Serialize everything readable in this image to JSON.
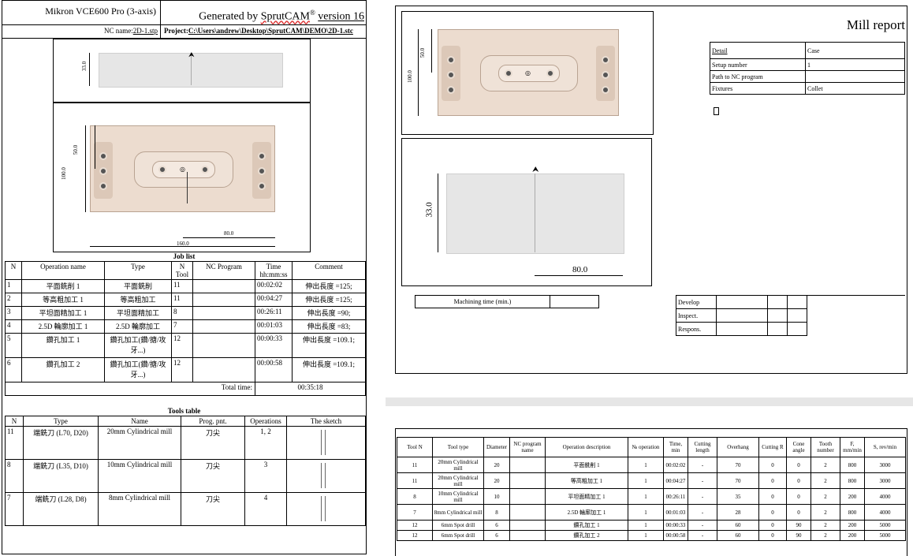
{
  "header": {
    "machine": "Mikron VCE600 Pro (3-axis)",
    "generated_prefix": "Generated by ",
    "product": "SprutCAM",
    "registered": "®",
    "version": "version 16",
    "nc_name_label": "NC name:",
    "nc_name_value": "2D-1.stp",
    "project_label": "Project:",
    "project_path": "C:\\Users\\andrew\\Desktop\\SprutCAM\\DEMO\\2D-1.stc"
  },
  "dims": {
    "top_height": "33.0",
    "inner_height": "50.0",
    "total_height": "100.0",
    "half_width": "80.0",
    "total_width": "160.0"
  },
  "job_list": {
    "title": "Job list",
    "headers": [
      "N",
      "Operation name",
      "Type",
      "N Tool",
      "NC Program",
      "Time hh:mm:ss",
      "Comment"
    ],
    "rows": [
      {
        "n": "1",
        "name": "平面銑削 1",
        "type": "平面銑削",
        "tool": "11",
        "nc": "",
        "time": "00:02:02",
        "comment": "伸出長度 =125;"
      },
      {
        "n": "2",
        "name": "等高粗加工 1",
        "type": "等高粗加工",
        "tool": "11",
        "nc": "",
        "time": "00:04:27",
        "comment": "伸出長度 =125;"
      },
      {
        "n": "3",
        "name": "平坦面精加工 1",
        "type": "平坦面精加工",
        "tool": "8",
        "nc": "",
        "time": "00:26:11",
        "comment": "伸出長度 =90;"
      },
      {
        "n": "4",
        "name": "2.5D 輪廓加工 1",
        "type": "2.5D 輪廓加工",
        "tool": "7",
        "nc": "",
        "time": "00:01:03",
        "comment": "伸出長度 =83;"
      },
      {
        "n": "5",
        "name": "鑽孔加工 1",
        "type": "鑽孔加工(鑽/搪/攻牙...)",
        "tool": "12",
        "nc": "",
        "time": "00:00:33",
        "comment": "伸出長度 =109.1;"
      },
      {
        "n": "6",
        "name": "鑽孔加工 2",
        "type": "鑽孔加工(鑽/搪/攻牙...)",
        "tool": "12",
        "nc": "",
        "time": "00:00:58",
        "comment": "伸出長度 =109.1;"
      }
    ],
    "total_label": "Total time:",
    "total_value": "00:35:18"
  },
  "tools_table": {
    "title": "Tools table",
    "headers": [
      "N",
      "Type",
      "Name",
      "Prog. pnt.",
      "Operations",
      "The sketch"
    ],
    "rows": [
      {
        "n": "11",
        "type": "端銑刀 (L70, D20)",
        "name": "20mm Cylindrical mill",
        "pnt": "刀尖",
        "ops": "1, 2"
      },
      {
        "n": "8",
        "type": "端銑刀 (L35, D10)",
        "name": "10mm Cylindrical mill",
        "pnt": "刀尖",
        "ops": "3"
      },
      {
        "n": "7",
        "type": "端銑刀 (L28, D8)",
        "name": "8mm Cylindrical mill",
        "pnt": "刀尖",
        "ops": "4"
      }
    ]
  },
  "mill_report": {
    "title": "Mill report",
    "info": [
      {
        "label": "Detail",
        "value": "Case"
      },
      {
        "label": "Setup number",
        "value": "1"
      },
      {
        "label": "Path to NC program",
        "value": ""
      },
      {
        "label": "Fixtures",
        "value": "Collet"
      }
    ],
    "machining_time_label": "Machining time (min.)",
    "machining_time_value": "",
    "signoff": [
      "Develop",
      "Inspect.",
      "Respons."
    ]
  },
  "ops_table": {
    "headers": [
      "Tool N",
      "Tool type",
      "Diameter",
      "NC program name",
      "Operation description",
      "№ operation",
      "Time, min",
      "Cutting length",
      "Overhang",
      "Cutting R",
      "Cone angle",
      "Tooth number",
      "F, mm/min",
      "S, rev/min"
    ],
    "rows": [
      [
        "11",
        "20mm Cylindrical mill",
        "20",
        "",
        "平面銑削 1",
        "1",
        "00:02:02",
        "-",
        "70",
        "0",
        "0",
        "2",
        "800",
        "3000"
      ],
      [
        "11",
        "20mm Cylindrical mill",
        "20",
        "",
        "等高粗加工 1",
        "1",
        "00:04:27",
        "-",
        "70",
        "0",
        "0",
        "2",
        "800",
        "3000"
      ],
      [
        "8",
        "10mm Cylindrical mill",
        "10",
        "",
        "平坦面精加工 1",
        "1",
        "00:26:11",
        "-",
        "35",
        "0",
        "0",
        "2",
        "200",
        "4000"
      ],
      [
        "7",
        "8mm Cylindrical mill",
        "8",
        "",
        "2.5D 輪廓加工 1",
        "1",
        "00:01:03",
        "-",
        "28",
        "0",
        "0",
        "2",
        "800",
        "4000"
      ],
      [
        "12",
        "6mm Spot drill",
        "6",
        "",
        "鑽孔加工 1",
        "1",
        "00:00:33",
        "-",
        "60",
        "0",
        "90",
        "2",
        "200",
        "5000"
      ],
      [
        "12",
        "6mm Spot drill",
        "6",
        "",
        "鑽孔加工 2",
        "1",
        "00:00:58",
        "-",
        "60",
        "0",
        "90",
        "2",
        "200",
        "5000"
      ]
    ]
  }
}
